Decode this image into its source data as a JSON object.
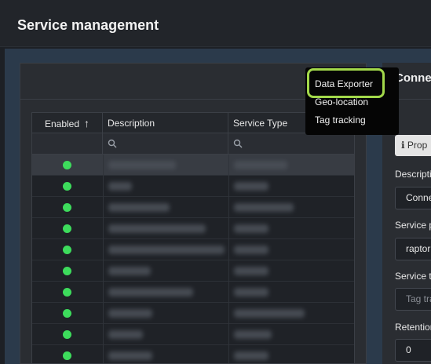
{
  "header": {
    "title": "Service management"
  },
  "grid": {
    "columns": [
      {
        "label": "Enabled",
        "sort_icon": "arrow-up-icon"
      },
      {
        "label": "Description"
      },
      {
        "label": "Service Type"
      }
    ],
    "filter_icon": "search-icon",
    "rows": [
      {
        "enabled": true,
        "selected": true
      },
      {
        "enabled": true
      },
      {
        "enabled": true
      },
      {
        "enabled": true
      },
      {
        "enabled": true
      },
      {
        "enabled": true
      },
      {
        "enabled": true
      },
      {
        "enabled": true
      },
      {
        "enabled": true
      },
      {
        "enabled": true
      }
    ],
    "status_color": "#3ddc5c"
  },
  "right_panel": {
    "title": "Conne",
    "properties_tab": "Prop",
    "properties_icon": "info-icon",
    "fields": [
      {
        "label": "Descripti",
        "value": "Conne"
      },
      {
        "label": "Service p",
        "value": "raptor"
      },
      {
        "label": "Service t",
        "placeholder": "Tag tra"
      },
      {
        "label": "Retention",
        "value": "0"
      }
    ]
  },
  "dropdown": {
    "items": [
      "Data Exporter",
      "Geo-location",
      "Tag tracking"
    ],
    "highlight_color": "#a2d84a"
  }
}
